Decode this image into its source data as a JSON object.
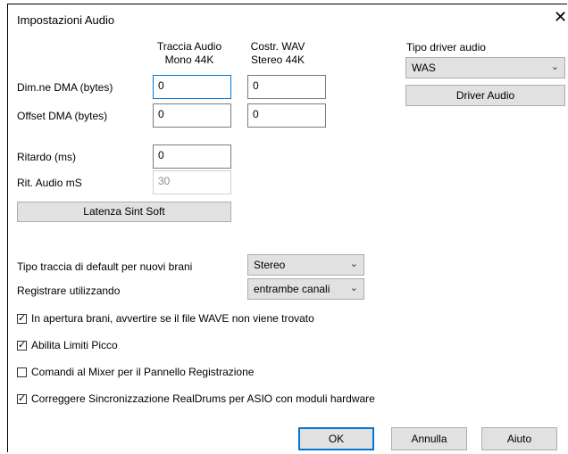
{
  "window": {
    "title": "Impostazioni Audio",
    "close_symbol": "✕"
  },
  "columns": {
    "col1_line1": "Traccia Audio",
    "col1_line2": "Mono 44K",
    "col2_line1": "Costr. WAV",
    "col2_line2": "Stereo 44K"
  },
  "dma_size": {
    "label": "Dim.ne DMA (bytes)",
    "mono_value": "0",
    "stereo_value": "0"
  },
  "dma_offset": {
    "label": "Offset DMA (bytes)",
    "mono_value": "0",
    "stereo_value": "0"
  },
  "delay": {
    "label": "Ritardo (ms)",
    "value": "0"
  },
  "audio_ms": {
    "label": "Rit. Audio mS",
    "value": "30"
  },
  "latency_button": "Latenza Sint Soft",
  "driver": {
    "label": "Tipo driver audio",
    "selected": "WAS",
    "button": "Driver Audio"
  },
  "track_type": {
    "label": "Tipo traccia di default per nuovi brani",
    "selected": "Stereo"
  },
  "record_using": {
    "label": "Registrare utilizzando",
    "selected": "entrambe canali"
  },
  "checkboxes": [
    {
      "label": "In apertura brani, avvertire se il file WAVE non viene trovato",
      "checked": true
    },
    {
      "label": "Abilita Limiti Picco",
      "checked": true
    },
    {
      "label": "Comandi al Mixer per il Pannello Registrazione",
      "checked": false
    },
    {
      "label": "Correggere Sincronizzazione RealDrums per ASIO con moduli hardware",
      "checked": true
    }
  ],
  "footer": {
    "ok": "OK",
    "cancel": "Annulla",
    "help": "Aiuto"
  },
  "icons": {
    "dropdown": "chevron-down-icon",
    "check": "checkmark-icon",
    "close": "close-icon"
  },
  "colors": {
    "focus_border": "#0078d7",
    "button_bg": "#e1e1e1"
  }
}
